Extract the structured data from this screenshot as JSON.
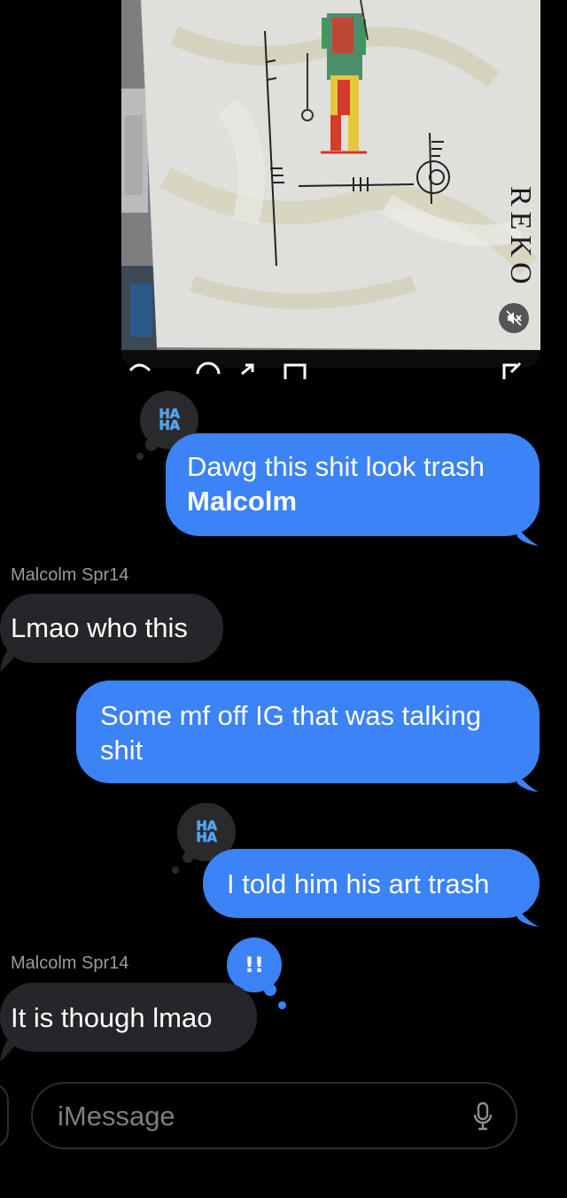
{
  "media": {
    "artwork_text": "REKO",
    "colors": {
      "canvas": "#dedfda",
      "paint": "#cfcab0",
      "figure_red": "#d23c2a",
      "figure_green": "#3f9a5a",
      "figure_yellow": "#e6c640"
    }
  },
  "messages": [
    {
      "id": "m1",
      "direction": "outgoing",
      "line1": "Dawg this shit look trash",
      "line2": "Malcolm",
      "tapback": "HA HA"
    },
    {
      "id": "m2",
      "direction": "incoming",
      "sender": "Malcolm Spr14",
      "text": "Lmao who this"
    },
    {
      "id": "m3",
      "direction": "outgoing",
      "line1": "Some mf off IG that was talking",
      "line2": "shit"
    },
    {
      "id": "m4",
      "direction": "outgoing",
      "text": "I told him his art trash",
      "tapback": "HA HA"
    },
    {
      "id": "m5",
      "direction": "incoming",
      "sender": "Malcolm Spr14",
      "text": "It is though lmao",
      "tapback": "!!"
    }
  ],
  "tapbacks": {
    "haha_line1": "HA",
    "haha_line2": "HA",
    "emphasize": "!!"
  },
  "compose": {
    "placeholder": "iMessage"
  },
  "colors": {
    "sent_bubble": "#3b83f6",
    "received_bubble": "#26252a",
    "background": "#000000",
    "tapback_bg": "#2a2a2d",
    "tapback_emphasize_bg": "#3b83f6"
  }
}
